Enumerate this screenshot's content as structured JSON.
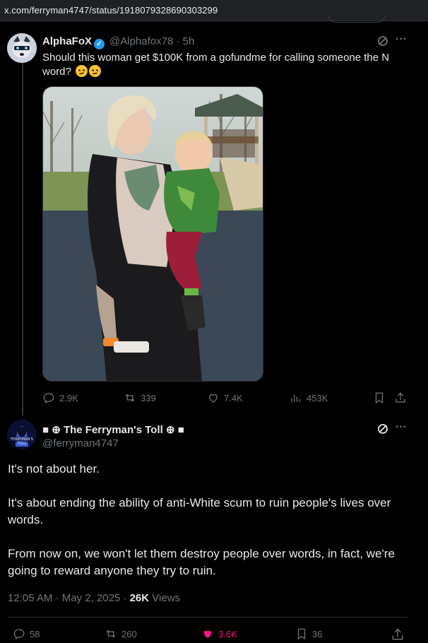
{
  "browser": {
    "url": "x.com/ferryman4747/status/1918079328690303299"
  },
  "quoted_tweet": {
    "display_name": "AlphaFoX",
    "handle_time": "@Alphafox78 · 5h",
    "text": "Should this woman get $100K from a gofundme for calling someone the N word?",
    "stats": {
      "replies": "2.9K",
      "reposts": "339",
      "likes": "7.4K",
      "views": "453K"
    }
  },
  "main_tweet": {
    "display_name": "■ ⊕ The Ferryman's Toll ⊕ ■",
    "handle": "@ferryman4747",
    "paragraphs": [
      "It's not about her.",
      "It's about ending the ability of anti-White scum to ruin people's lives over words.",
      "From now on, we won't let them destroy people over words, in fact, we're going to reward anyone they try to ruin."
    ],
    "timestamp": "12:05 AM · May 2, 2025 · ",
    "views_count": "26K",
    "views_label": " Views",
    "stats": {
      "replies": "58",
      "reposts": "260",
      "likes": "3.6K",
      "bookmarks": "36"
    }
  },
  "colors": {
    "accent": "#1d9bf0",
    "like_pink": "#f91880",
    "muted": "#71767b",
    "text": "#e7e9ea"
  },
  "icons": [
    "reply-icon",
    "repost-icon",
    "like-icon",
    "views-icon",
    "bookmark-icon",
    "share-icon",
    "grok-icon",
    "more-icon",
    "verified-icon"
  ]
}
